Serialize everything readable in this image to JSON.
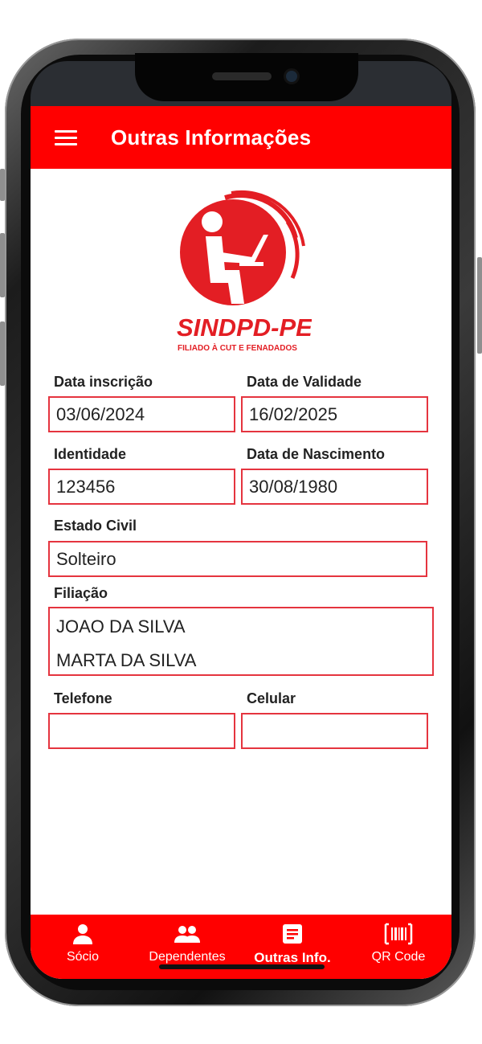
{
  "app": {
    "title": "Outras Informações",
    "brand": {
      "name": "SINDPD-PE",
      "tagline": "FILIADO À CUT E FENADADOS",
      "color": "#e31e24"
    }
  },
  "form": {
    "data_inscricao": {
      "label": "Data inscrição",
      "value": "03/06/2024"
    },
    "data_validade": {
      "label": "Data de Validade",
      "value": "16/02/2025"
    },
    "identidade": {
      "label": "Identidade",
      "value": "123456"
    },
    "data_nascimento": {
      "label": "Data de Nascimento",
      "value": "30/08/1980"
    },
    "estado_civil": {
      "label": "Estado Civil",
      "value": "Solteiro"
    },
    "filiacao": {
      "label": "Filiação",
      "value": "JOAO DA SILVA\nMARTA DA SILVA"
    },
    "telefone": {
      "label": "Telefone",
      "value": ""
    },
    "celular": {
      "label": "Celular",
      "value": ""
    }
  },
  "bottom_nav": {
    "items": [
      {
        "label": "Sócio",
        "icon": "person-icon"
      },
      {
        "label": "Dependentes",
        "icon": "people-icon"
      },
      {
        "label": "Outras Info.",
        "icon": "document-icon",
        "active": true
      },
      {
        "label": "QR Code",
        "icon": "barcode-icon"
      }
    ]
  },
  "colors": {
    "accent": "#ff0000",
    "field_border": "#e5343f"
  }
}
